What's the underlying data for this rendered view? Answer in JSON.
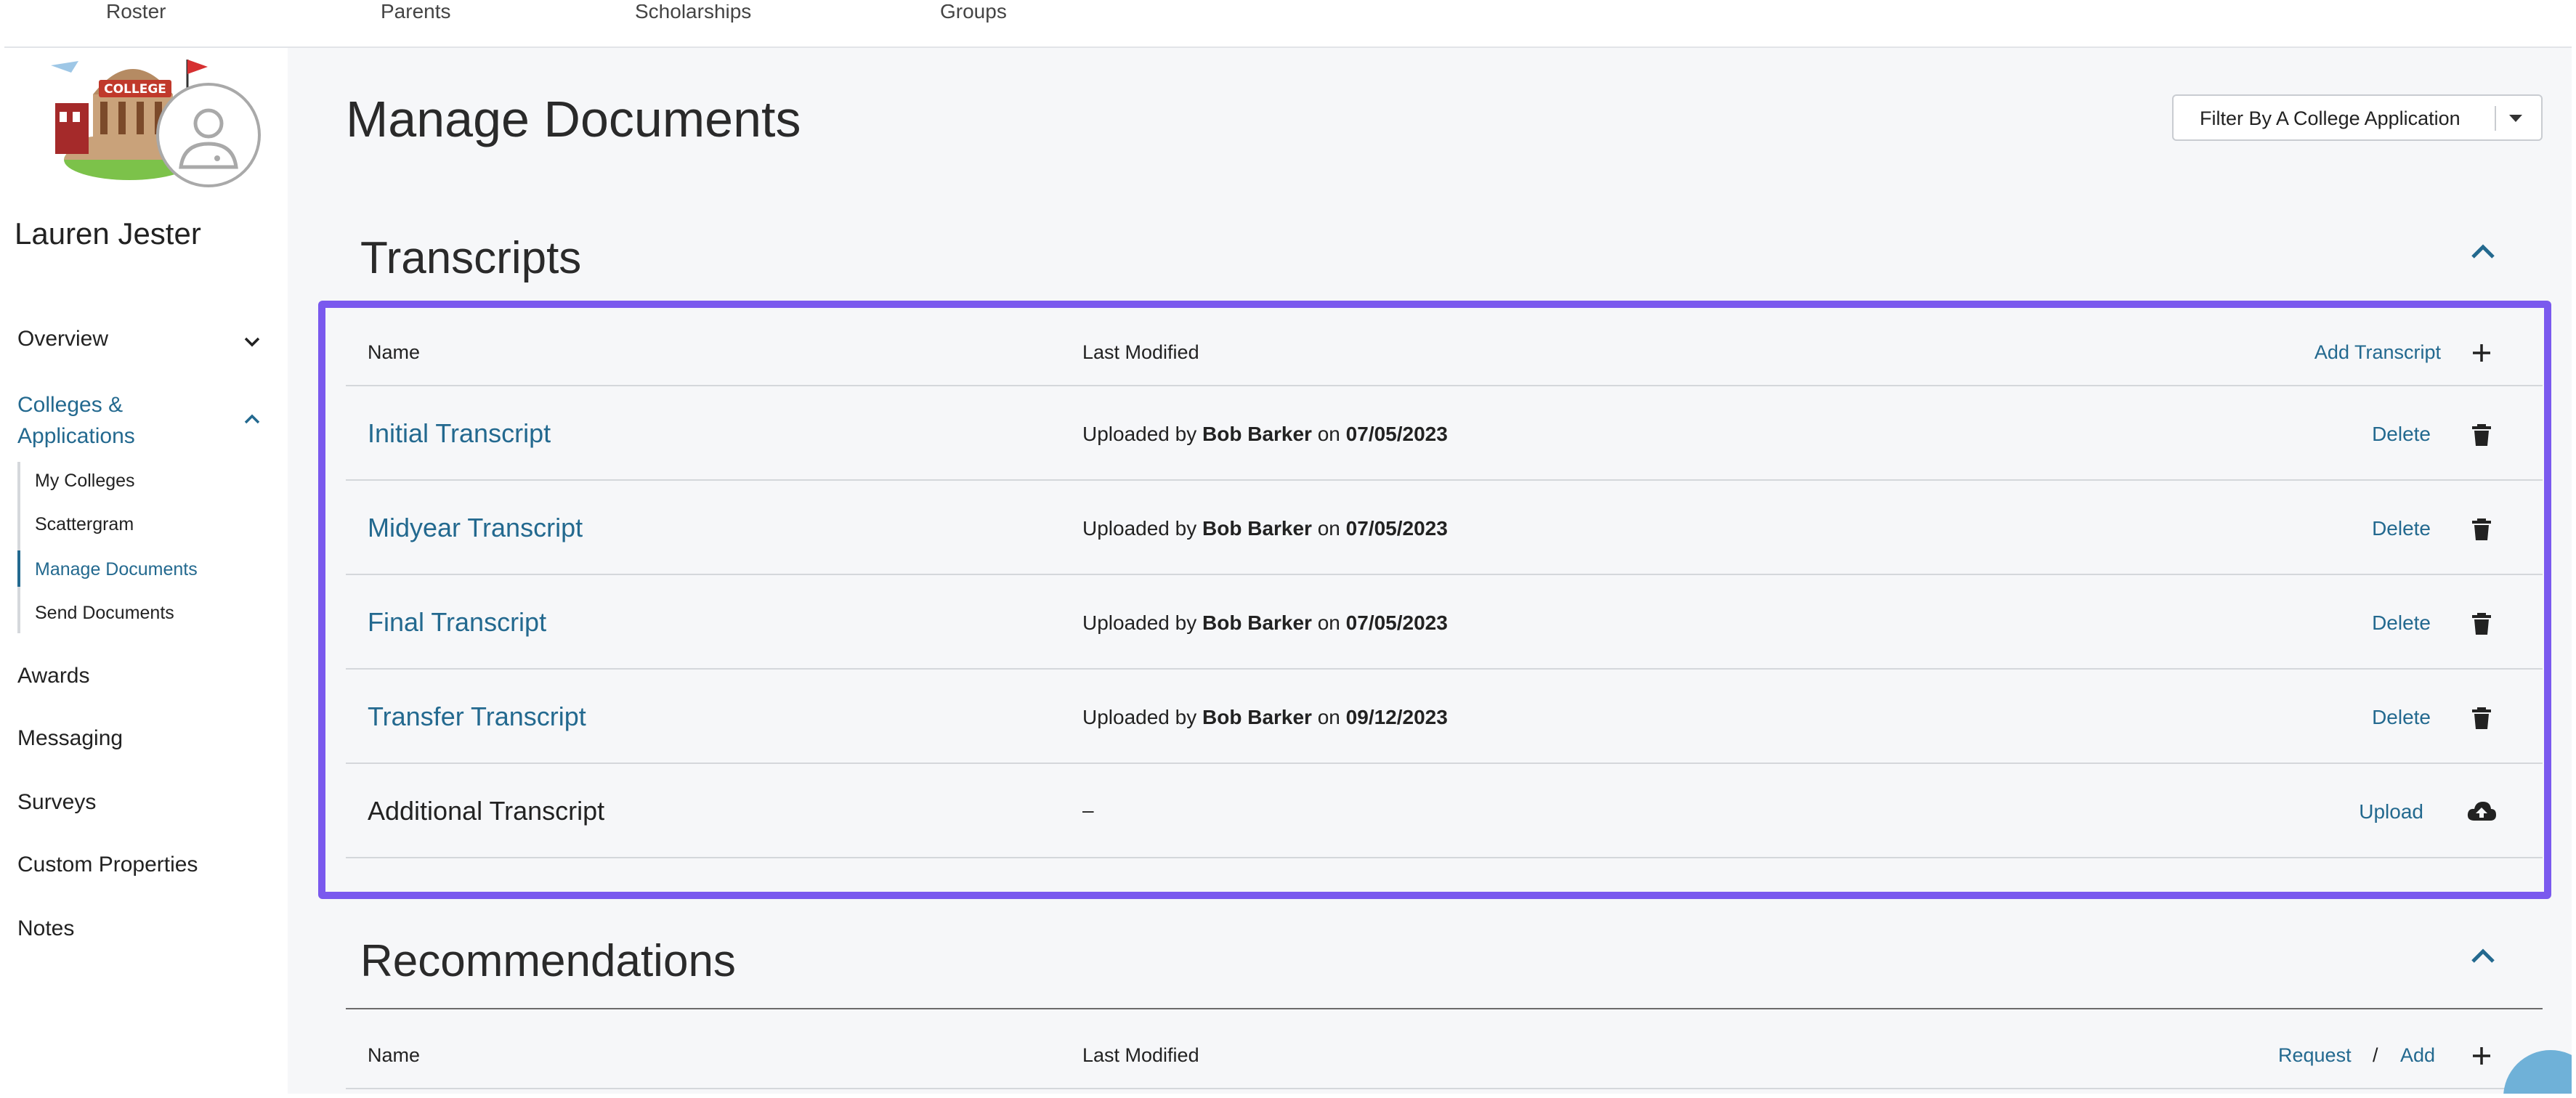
{
  "topnav": {
    "items": [
      "Roster",
      "Parents",
      "Scholarships",
      "Groups"
    ]
  },
  "sidebar": {
    "logo_text": "COLLEGE",
    "student_name": "Lauren Jester",
    "items": [
      {
        "label": "Overview"
      },
      {
        "label_line1": "Colleges &",
        "label_line2": "Applications"
      },
      {
        "label": "Awards"
      },
      {
        "label": "Messaging"
      },
      {
        "label": "Surveys"
      },
      {
        "label": "Custom Properties"
      },
      {
        "label": "Notes"
      }
    ],
    "sub_items": [
      "My Colleges",
      "Scattergram",
      "Manage Documents",
      "Send Documents"
    ]
  },
  "main": {
    "title": "Manage Documents",
    "filter_label": "Filter By A College Application",
    "transcripts": {
      "title": "Transcripts",
      "headers": {
        "name": "Name",
        "modified": "Last Modified",
        "add": "Add Transcript"
      },
      "rows": [
        {
          "name": "Initial Transcript",
          "uploaded_prefix": "Uploaded by",
          "user": "Bob Barker",
          "on": "on",
          "date": "07/05/2023",
          "action": "Delete"
        },
        {
          "name": "Midyear Transcript",
          "uploaded_prefix": "Uploaded by",
          "user": "Bob Barker",
          "on": "on",
          "date": "07/05/2023",
          "action": "Delete"
        },
        {
          "name": "Final Transcript",
          "uploaded_prefix": "Uploaded by",
          "user": "Bob Barker",
          "on": "on",
          "date": "07/05/2023",
          "action": "Delete"
        },
        {
          "name": "Transfer Transcript",
          "uploaded_prefix": "Uploaded by",
          "user": "Bob Barker",
          "on": "on",
          "date": "09/12/2023",
          "action": "Delete"
        }
      ],
      "additional": {
        "name": "Additional Transcript",
        "modified": "–",
        "action": "Upload"
      }
    },
    "recommendations": {
      "title": "Recommendations",
      "headers": {
        "name": "Name",
        "modified": "Last Modified",
        "request": "Request",
        "slash": "/",
        "add": "Add"
      }
    }
  },
  "colors": {
    "accent": "#23698f",
    "highlight": "#7a59ee"
  }
}
